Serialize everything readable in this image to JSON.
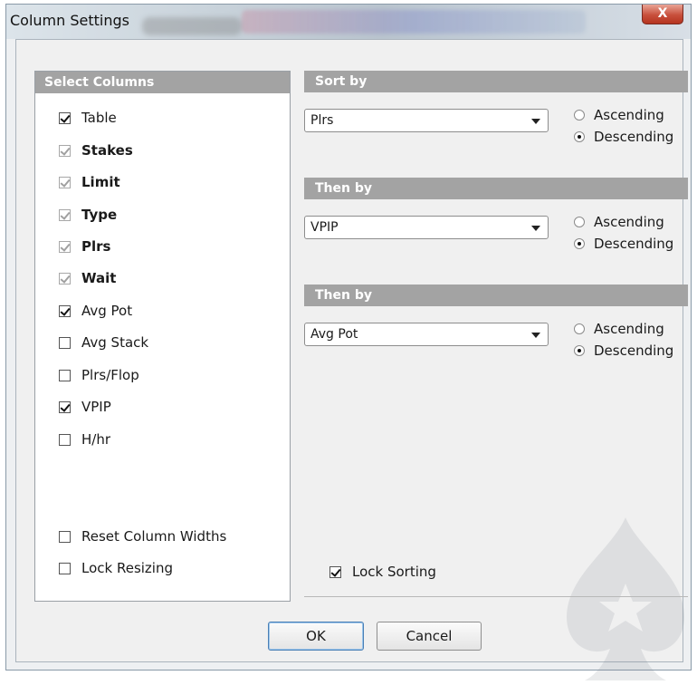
{
  "window": {
    "title": "Column Settings",
    "close_label": "X"
  },
  "columns_panel": {
    "header": "Select Columns",
    "items": [
      {
        "label": "Table",
        "checked": true,
        "bold": false,
        "locked": false
      },
      {
        "label": "Stakes",
        "checked": true,
        "bold": true,
        "locked": true
      },
      {
        "label": "Limit",
        "checked": true,
        "bold": true,
        "locked": true
      },
      {
        "label": "Type",
        "checked": true,
        "bold": true,
        "locked": true
      },
      {
        "label": "Plrs",
        "checked": true,
        "bold": true,
        "locked": true
      },
      {
        "label": "Wait",
        "checked": true,
        "bold": true,
        "locked": true
      },
      {
        "label": "Avg Pot",
        "checked": true,
        "bold": false,
        "locked": false
      },
      {
        "label": "Avg Stack",
        "checked": false,
        "bold": false,
        "locked": false
      },
      {
        "label": "Plrs/Flop",
        "checked": false,
        "bold": false,
        "locked": false
      },
      {
        "label": "VPIP",
        "checked": true,
        "bold": false,
        "locked": false
      },
      {
        "label": "H/hr",
        "checked": false,
        "bold": false,
        "locked": false
      }
    ],
    "reset_widths": {
      "label": "Reset Column Widths",
      "checked": false
    },
    "lock_resizing": {
      "label": "Lock Resizing",
      "checked": false
    }
  },
  "sorting": [
    {
      "header": "Sort by",
      "selected": "Plrs",
      "ascending_label": "Ascending",
      "descending_label": "Descending",
      "order": "descending"
    },
    {
      "header": "Then by",
      "selected": "VPIP",
      "ascending_label": "Ascending",
      "descending_label": "Descending",
      "order": "descending"
    },
    {
      "header": "Then by",
      "selected": "Avg Pot",
      "ascending_label": "Ascending",
      "descending_label": "Descending",
      "order": "descending"
    }
  ],
  "lock_sorting": {
    "label": "Lock Sorting",
    "checked": true
  },
  "buttons": {
    "ok": "OK",
    "cancel": "Cancel"
  },
  "colors": {
    "section_header": "#a3a3a3",
    "dialog_bg": "#f0f0f0",
    "close_button": "#c8503c"
  }
}
